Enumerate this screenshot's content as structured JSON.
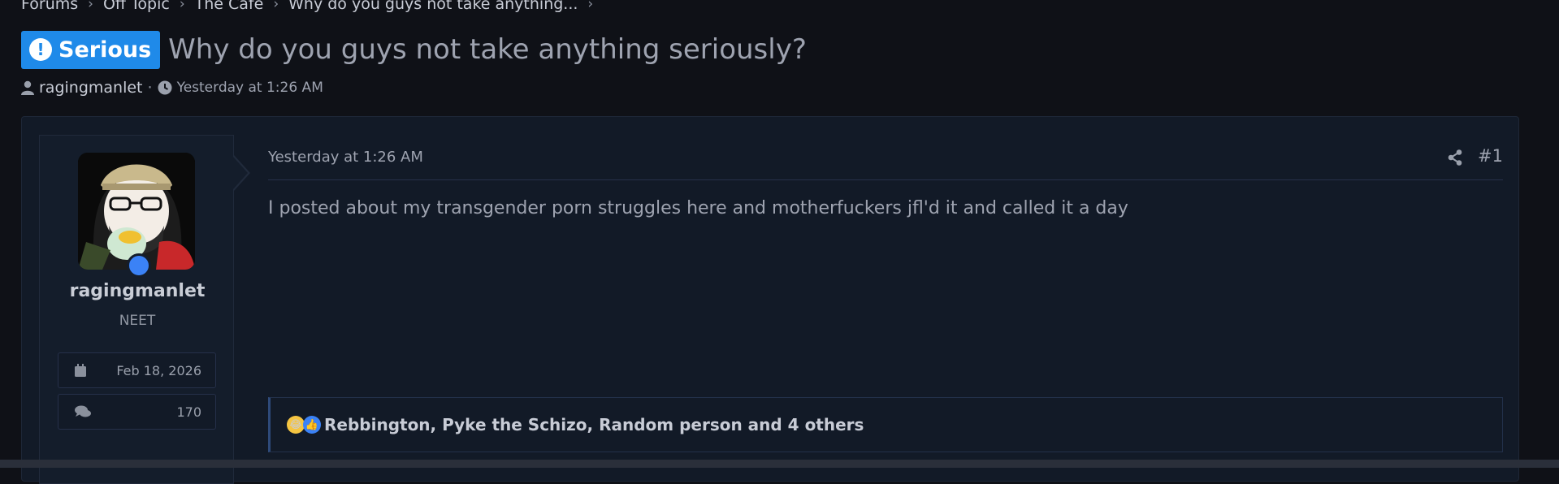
{
  "breadcrumb": {
    "items": [
      "Forums",
      "Off Topic",
      "The Cafe",
      "Why do you guys not take anything..."
    ]
  },
  "thread": {
    "prefix_label": "Serious",
    "prefix_icon": "exclamation-icon",
    "title": "Why do you guys not take anything seriously?",
    "author": "ragingmanlet",
    "separator": "·",
    "date": "Yesterday at 1:26 AM"
  },
  "post": {
    "date": "Yesterday at 1:26 AM",
    "number": "#1",
    "body": "I posted about my transgender porn struggles here and motherfuckers jfl'd it and called it a day",
    "user": {
      "name": "ragingmanlet",
      "title": "NEET",
      "joined": "Feb 18, 2026",
      "messages": "170"
    },
    "reactions": {
      "icons": [
        "laughing-crying-icon",
        "thumbs-up-icon"
      ],
      "text": "Rebbington, Pyke the Schizo, Random person and 4 others"
    }
  },
  "colors": {
    "accent": "#1f8ae9",
    "background": "#0f1117",
    "panel": "#121a27",
    "online": "#3b82f6"
  }
}
